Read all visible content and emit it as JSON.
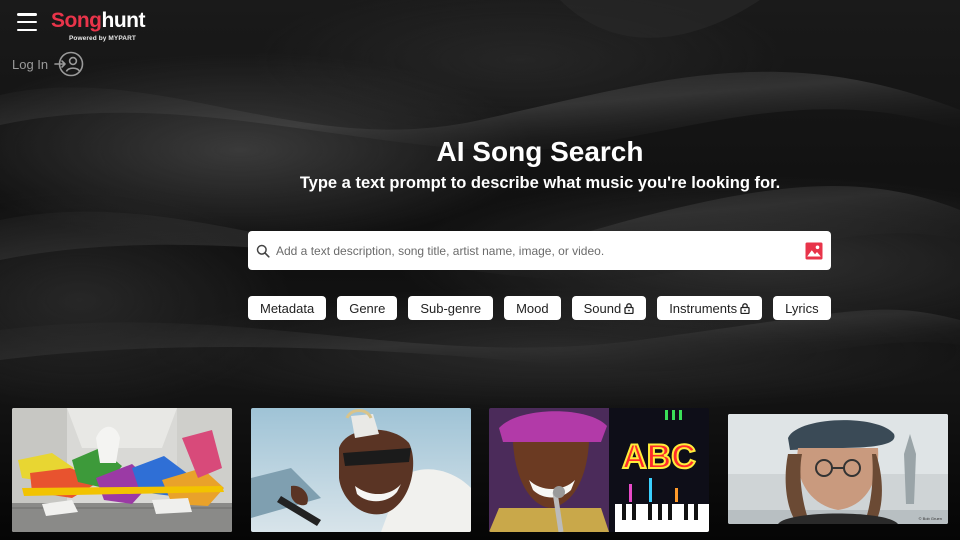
{
  "brand": {
    "name_part1": "Song",
    "name_part2": "hunt",
    "powered_by": "Powered by MYPART",
    "color": "#e8344a"
  },
  "header": {
    "menu_icon": "hamburger-icon",
    "login_label": "Log In",
    "login_icon": "user-login-icon"
  },
  "hero": {
    "title": "AI Song Search",
    "subtitle": "Type a text prompt to describe what music you're looking for."
  },
  "search": {
    "placeholder": "Add a text description, song title, artist name, image, or video.",
    "value": "",
    "search_icon": "search-icon",
    "upload_icon": "image-upload-icon"
  },
  "filters": [
    {
      "label": "Metadata",
      "locked": false
    },
    {
      "label": "Genre",
      "locked": false
    },
    {
      "label": "Sub-genre",
      "locked": false
    },
    {
      "label": "Mood",
      "locked": false
    },
    {
      "label": "Sound",
      "locked": true
    },
    {
      "label": "Instruments",
      "locked": true
    },
    {
      "label": "Lyrics",
      "locked": false
    }
  ],
  "thumbnails": [
    {
      "name": "colorful-art-installation"
    },
    {
      "name": "dancing-man-sunglasses"
    },
    {
      "name": "abc-kid-singer",
      "overlay_text": "ABC"
    },
    {
      "name": "man-in-cap-glasses",
      "credit": "© Bob Gruen"
    }
  ]
}
